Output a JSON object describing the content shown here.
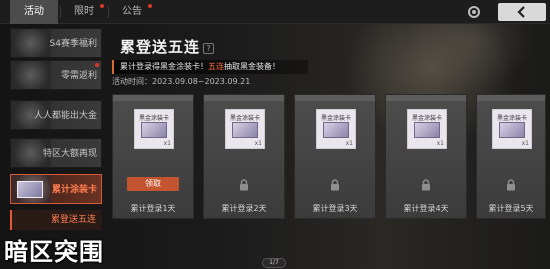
{
  "tabs": [
    {
      "label": "活动",
      "active": true
    },
    {
      "label": "限时",
      "active": false
    },
    {
      "label": "公告",
      "active": false
    }
  ],
  "sidebar": {
    "items": [
      {
        "label": "S4赛季福利"
      },
      {
        "label": "零需返利"
      },
      {
        "label": "人人都能出大金"
      },
      {
        "label": "特区大额再现"
      },
      {
        "label": "累计涂装卡",
        "active": true
      }
    ],
    "sub_selected": "累登送五连"
  },
  "event": {
    "title": "累登送五连",
    "help": "?",
    "desc_prefix": "累计登录得黑金涂装卡！",
    "desc_highlight": "五连",
    "desc_suffix": "抽取黑金装备！",
    "period": "活动时间：2023.09.08~2023.09.21"
  },
  "reward": {
    "name": "黑金涂装卡",
    "count": "x1",
    "claim_label": "领取"
  },
  "days": [
    {
      "label": "累计登录1天",
      "state": "claimable"
    },
    {
      "label": "累计登录2天",
      "state": "locked"
    },
    {
      "label": "累计登录3天",
      "state": "locked"
    },
    {
      "label": "累计登录4天",
      "state": "locked"
    },
    {
      "label": "累计登录5天",
      "state": "locked"
    }
  ],
  "pager": "1/7",
  "watermark": "暗区突围",
  "colors": {
    "accent": "#d35a3a",
    "claim": "#c2542f",
    "highlight": "#ff6a3c"
  }
}
